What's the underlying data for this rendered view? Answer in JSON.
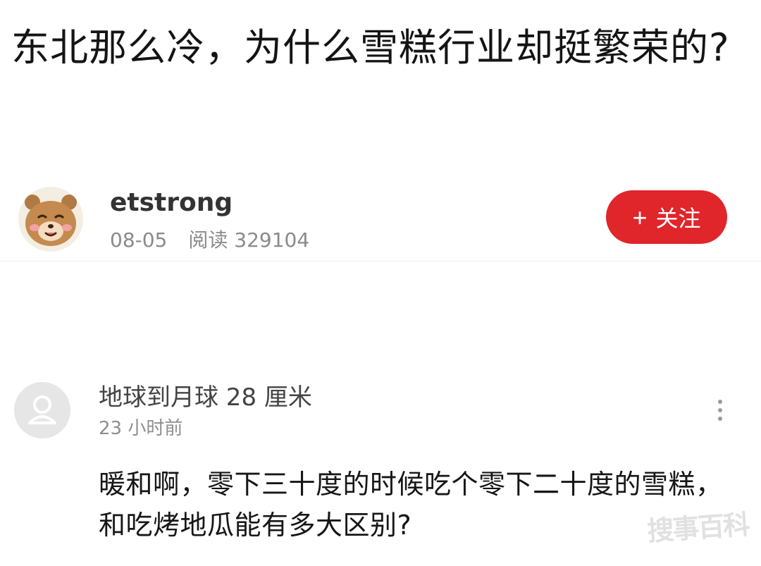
{
  "question": {
    "title": "东北那么冷，为什么雪糕行业却挺繁荣的?"
  },
  "author": {
    "name": "etstrong",
    "date": "08-05",
    "views": "阅读 329104",
    "avatar_icon": "bear-avatar-icon"
  },
  "follow_button": {
    "plus": "+",
    "label": "关注",
    "color": "#e0252b"
  },
  "comment": {
    "username": "地球到月球 28 厘米",
    "time": "23 小时前",
    "text": "暖和啊，零下三十度的时候吃个零下二十度的雪糕，和吃烤地瓜能有多大区别?",
    "avatar_icon": "default-user-icon",
    "more_icon": "more-vertical-icon"
  },
  "watermark": {
    "text": "搜事百科"
  }
}
